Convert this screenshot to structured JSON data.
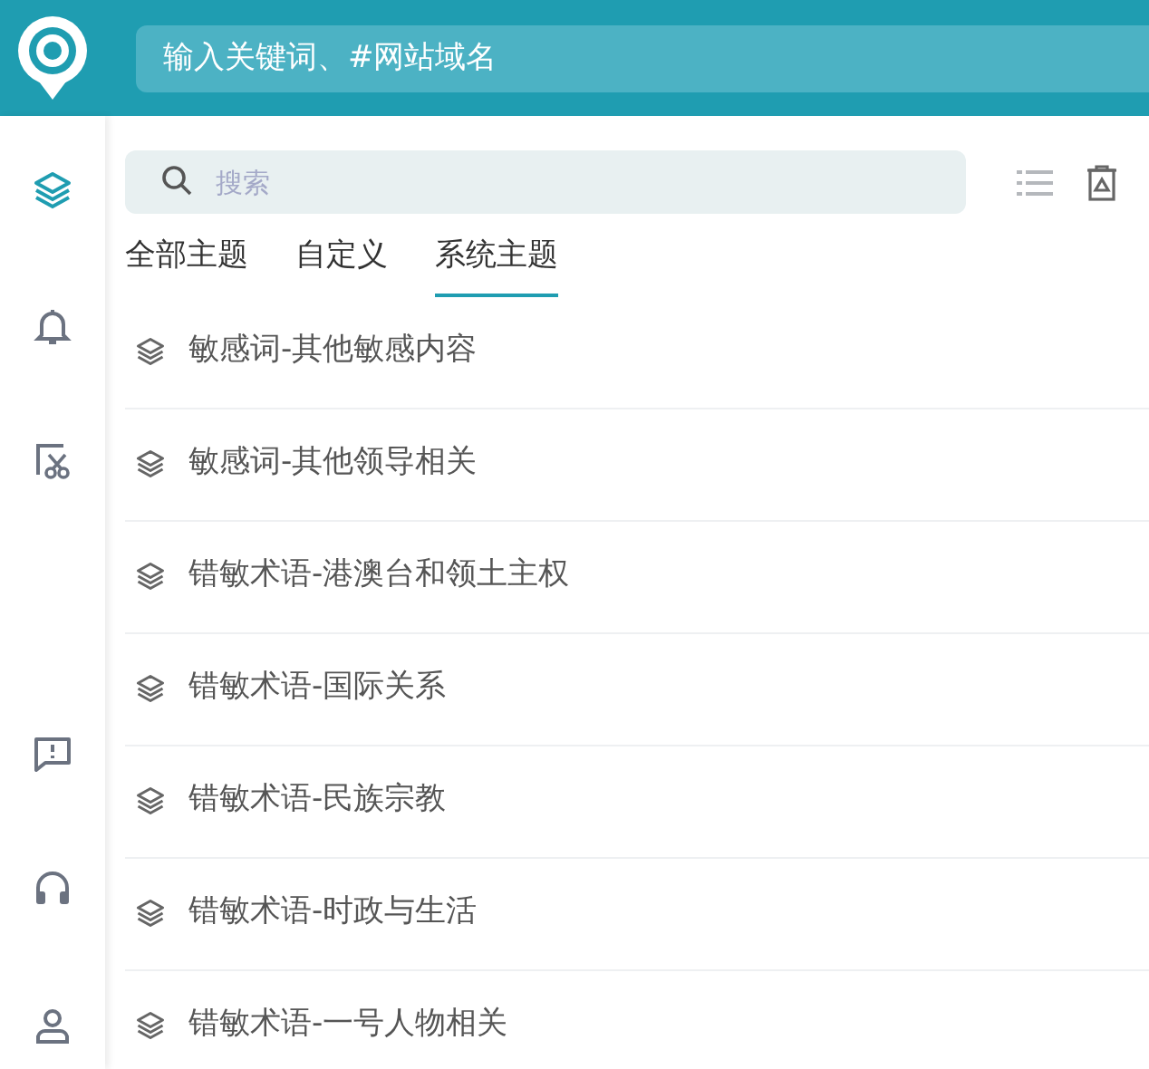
{
  "header": {
    "search_placeholder": "输入关键词、#网站域名"
  },
  "sidebar": {
    "items": [
      {
        "kind": "layers",
        "selected": true
      },
      {
        "kind": "bell",
        "selected": false
      },
      {
        "kind": "scissors",
        "selected": false
      },
      {
        "kind": "message",
        "selected": false
      },
      {
        "kind": "headphones",
        "selected": false
      },
      {
        "kind": "user",
        "selected": false
      }
    ]
  },
  "search": {
    "placeholder": "搜索"
  },
  "tabs": [
    {
      "label": "全部主题",
      "selected": false
    },
    {
      "label": "自定义",
      "selected": false
    },
    {
      "label": "系统主题",
      "selected": true
    }
  ],
  "topics": [
    {
      "label": "敏感词-其他敏感内容"
    },
    {
      "label": "敏感词-其他领导相关"
    },
    {
      "label": "错敏术语-港澳台和领土主权"
    },
    {
      "label": "错敏术语-国际关系"
    },
    {
      "label": "错敏术语-民族宗教"
    },
    {
      "label": "错敏术语-时政与生活"
    },
    {
      "label": "错敏术语-一号人物相关"
    }
  ]
}
